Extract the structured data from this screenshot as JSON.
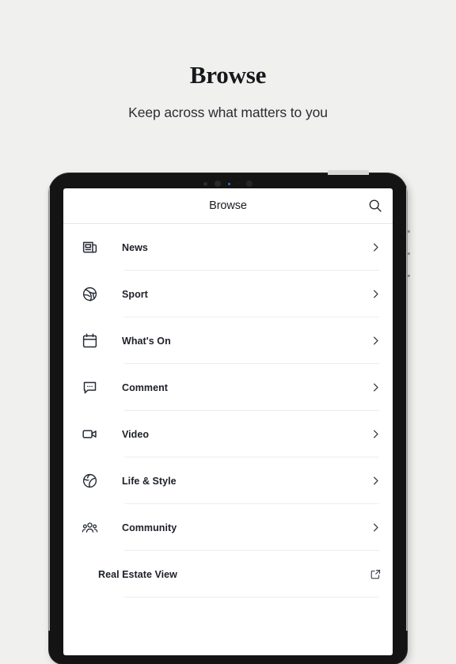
{
  "promo": {
    "title": "Browse",
    "subtitle": "Keep across what matters to you"
  },
  "device": {
    "type": "tablet-mockup",
    "sensors": [
      "camera-small",
      "camera-large",
      "status-led",
      "sensor-tiny",
      "camera-large"
    ],
    "led_color": "#2d6fd6",
    "bezel_color": "#141414"
  },
  "app": {
    "appbar": {
      "title": "Browse",
      "search_icon": "search-icon"
    },
    "list": [
      {
        "label": "News",
        "icon": "newspaper-icon",
        "accessory": "chevron-right-icon"
      },
      {
        "label": "Sport",
        "icon": "basketball-icon",
        "accessory": "chevron-right-icon"
      },
      {
        "label": "What's On",
        "icon": "calendar-icon",
        "accessory": "chevron-right-icon"
      },
      {
        "label": "Comment",
        "icon": "comment-icon",
        "accessory": "chevron-right-icon"
      },
      {
        "label": "Video",
        "icon": "video-icon",
        "accessory": "chevron-right-icon"
      },
      {
        "label": "Life & Style",
        "icon": "globe-icon",
        "accessory": "chevron-right-icon"
      },
      {
        "label": "Community",
        "icon": "people-icon",
        "accessory": "chevron-right-icon"
      },
      {
        "label": "Real Estate View",
        "icon": null,
        "accessory": "external-link-icon"
      }
    ]
  },
  "colors": {
    "page_background": "#f0f0ee",
    "screen_background": "#ffffff",
    "text_primary": "#1d2028",
    "divider": "#ededed",
    "icon": "#262b36"
  }
}
